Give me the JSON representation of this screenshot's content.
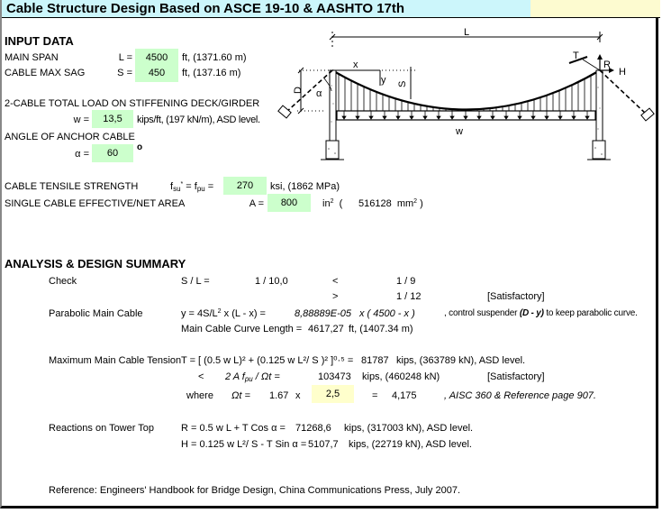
{
  "title": "Cable Structure Design Based on ASCE 19-10 & AASHTO 17th",
  "colors": {
    "title_bg": "#ccf6fb",
    "title_right_bg": "#fdfbd0",
    "input_bg": "#ccffcc",
    "factor_bg": "#ffffcc"
  },
  "input": {
    "heading": "INPUT DATA",
    "main_span": {
      "label": "MAIN SPAN",
      "symbol": "L =",
      "value": "4500",
      "unit": "ft, (1371.60 m)"
    },
    "max_sag": {
      "label": "CABLE MAX SAG",
      "symbol": "S =",
      "value": "450",
      "unit": "ft, (137.16 m)"
    },
    "load": {
      "label": "2-CABLE TOTAL LOAD ON STIFFENING DECK/GIRDER",
      "symbol": "w =",
      "value": "13,5",
      "unit": "kips/ft, (197 kN/m), ASD level."
    },
    "angle": {
      "label": "ANGLE OF ANCHOR CABLE",
      "symbol": "α =",
      "value": "60",
      "unit": "o"
    },
    "strength": {
      "label": "CABLE TENSILE STRENGTH",
      "symbol_a": "f",
      "sub_a": "su",
      "star": "*",
      "eq": " = f",
      "sub_b": "pu",
      "tail": " =",
      "value": "270",
      "unit": "ksi, (1862 MPa)"
    },
    "area": {
      "label": "SINGLE CABLE EFFECTIVE/NET AREA",
      "symbol": "A =",
      "value": "800",
      "unit": "in",
      "unit_sup": "2",
      "paren_open": "(",
      "mm_value": "516128",
      "mm_unit": "mm",
      "mm_sup": "2",
      "paren_close": ")"
    }
  },
  "diagram": {
    "labels": {
      "L": "L",
      "x": "x",
      "y": "y",
      "S": "S",
      "D": "D",
      "alpha": "α",
      "w": "w",
      "T": "T",
      "R": "R",
      "H": "H"
    }
  },
  "summary": {
    "heading": "ANALYSIS & DESIGN SUMMARY",
    "check": {
      "label": "Check",
      "formula": "S / L =",
      "value": "1 /  10,0",
      "lt": "<",
      "lt_value": "1 / 9",
      "gt": ">",
      "gt_value": "1 / 12",
      "status": "[Satisfactory]"
    },
    "parabolic": {
      "label": "Parabolic Main Cable",
      "formula_a": "y = 4S/L",
      "formula_sup": "2",
      "formula_b": " x (L - x) =",
      "coef": "8,88889E-05",
      "expr": "x ( 4500 - x )",
      "note_a": ", control suspender ",
      "note_em": "(D - y)",
      "note_b": " to keep parabolic curve.",
      "length_label": "Main Cable Curve Length =",
      "length_value": "4617,27",
      "length_unit": "ft, (1407.34 m)"
    },
    "tension": {
      "label": "Maximum Main Cable Tension",
      "formula": "T = [ (0.5 w L)² + (0.125 w L²/ S )² ]⁰·⁵ =",
      "value": "81787",
      "unit": "kips, (363789 kN), ASD level.",
      "lt": "<",
      "cap_formula": "2 A f",
      "cap_sub": "pu",
      "cap_tail": " / Ωt =",
      "cap_value": "103473",
      "cap_unit": "kips, (460248 kN)",
      "status": "[Satisfactory]",
      "where": "where",
      "omega": "Ωt =",
      "omega_a": "1.67",
      "times": "x",
      "omega_factor": "2,5",
      "eq": "=",
      "omega_result": "4,175",
      "ref": ", AISC 360 & Reference page 907."
    },
    "reactions": {
      "label": "Reactions on Tower Top",
      "r_formula": "R = 0.5 w L + T Cos α =",
      "r_value": "71268,6",
      "r_unit": "kips, (317003 kN), ASD level.",
      "h_formula": "H = 0.125 w L²/ S - T Sin α =",
      "h_value": "5107,7",
      "h_unit": "kips, (22719 kN), ASD level."
    },
    "reference": "Reference:  Engineers' Handbook for Bridge Design, China Communications Press, July 2007."
  }
}
